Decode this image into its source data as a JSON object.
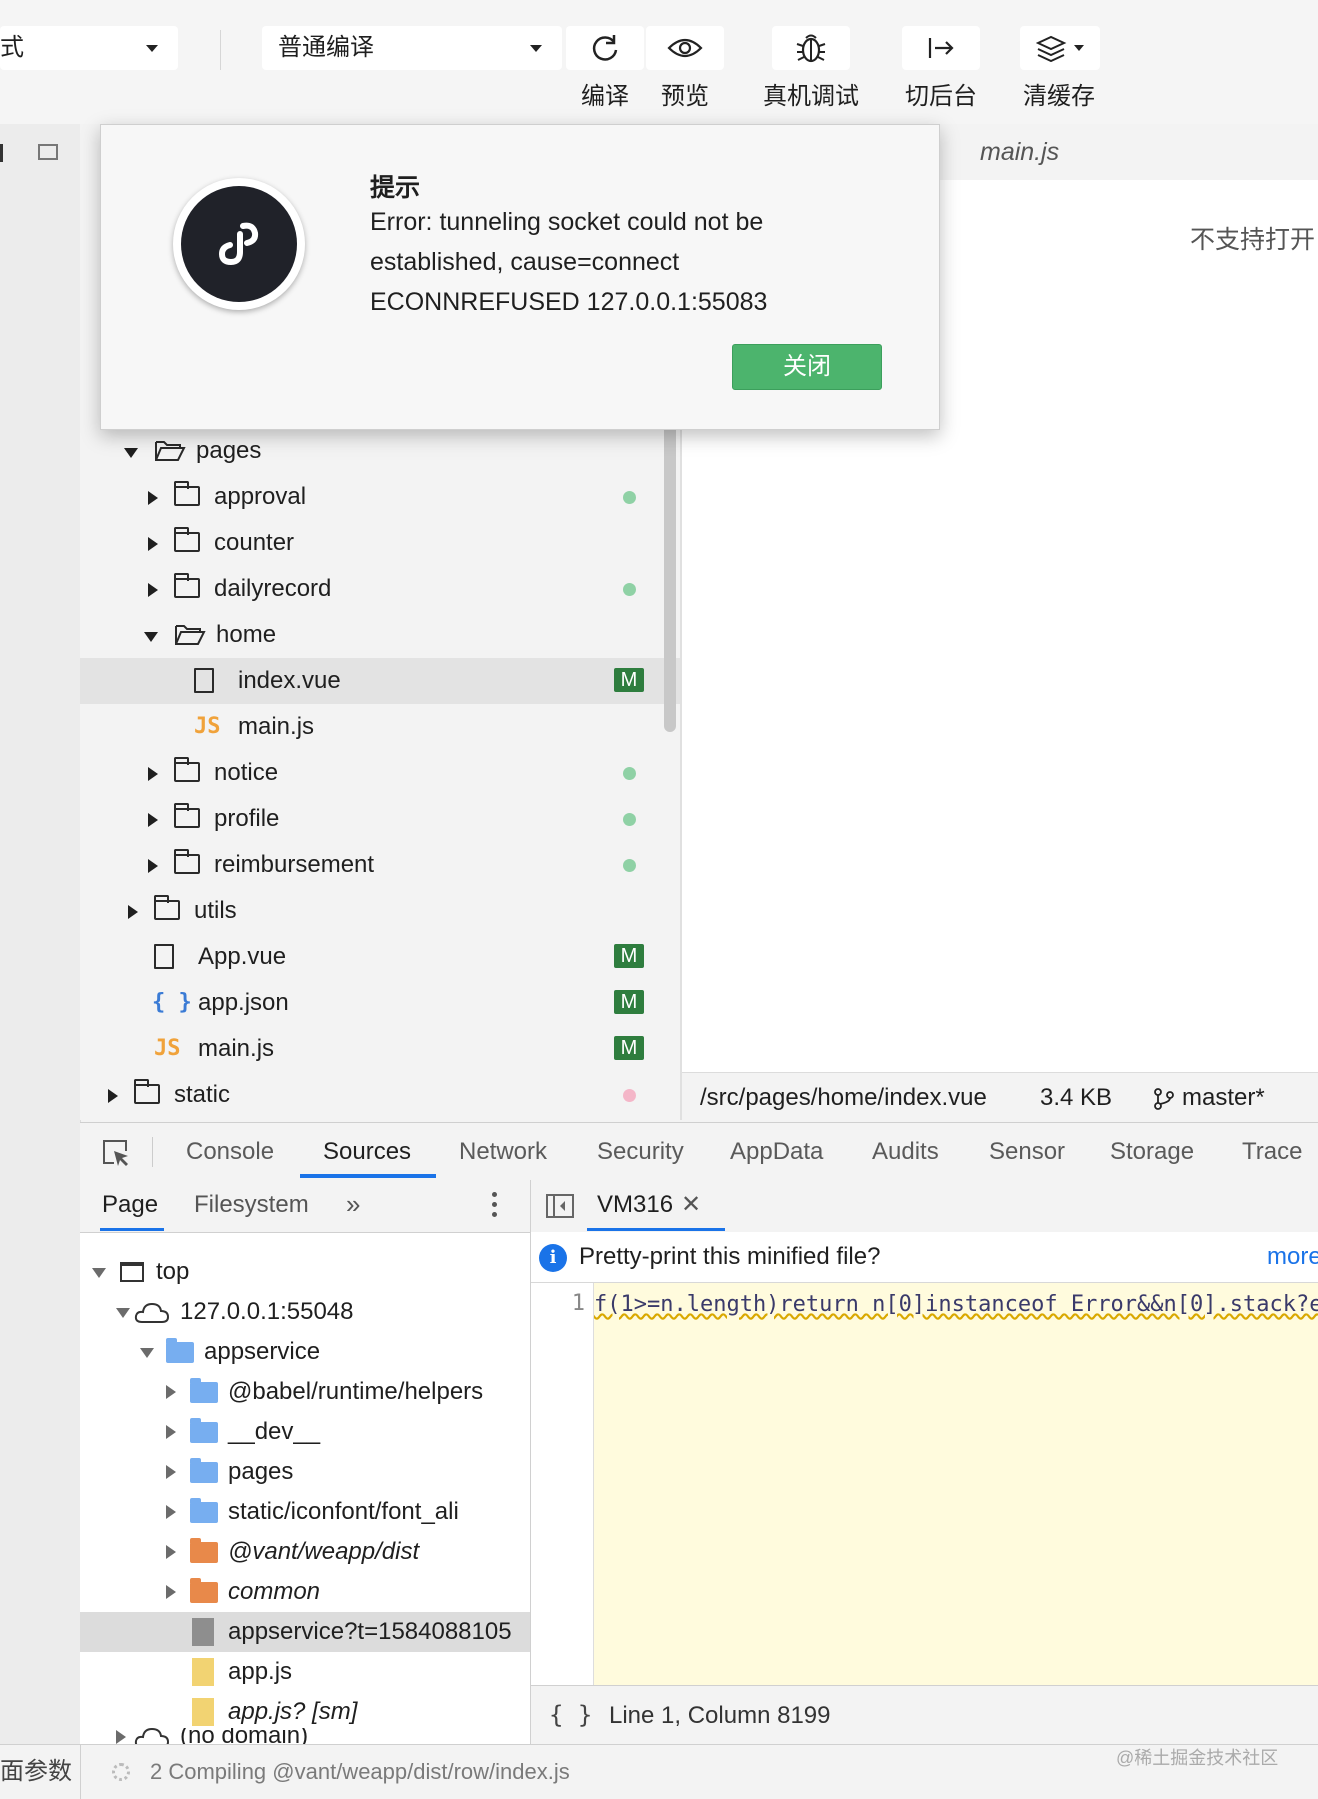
{
  "toolbar": {
    "mode_select": "式",
    "compile_select": "普通编译",
    "buttons": [
      {
        "name": "compile",
        "label": "编译",
        "icon": "refresh-icon"
      },
      {
        "name": "preview",
        "label": "预览",
        "icon": "eye-icon"
      },
      {
        "name": "remote-debug",
        "label": "真机调试",
        "icon": "bug-icon"
      },
      {
        "name": "background",
        "label": "切后台",
        "icon": "exit-arrow-icon"
      },
      {
        "name": "clear-cache",
        "label": "清缓存",
        "icon": "layers-icon"
      }
    ]
  },
  "editor": {
    "tab": "main.js",
    "unsupported_text": "不支持打开",
    "status": {
      "path": "/src/pages/home/index.vue",
      "size": "3.4 KB",
      "branch": "master*"
    }
  },
  "filetree": {
    "rows": [
      {
        "label": "pages",
        "type": "folder-open",
        "depth": 0
      },
      {
        "label": "approval",
        "type": "folder",
        "depth": 1,
        "status": "dot"
      },
      {
        "label": "counter",
        "type": "folder",
        "depth": 1
      },
      {
        "label": "dailyrecord",
        "type": "folder",
        "depth": 1,
        "status": "dot"
      },
      {
        "label": "home",
        "type": "folder-open",
        "depth": 1
      },
      {
        "label": "index.vue",
        "type": "file",
        "depth": 2,
        "status": "M",
        "selected": true
      },
      {
        "label": "main.js",
        "type": "js",
        "depth": 2
      },
      {
        "label": "notice",
        "type": "folder",
        "depth": 1,
        "status": "dot"
      },
      {
        "label": "profile",
        "type": "folder",
        "depth": 1,
        "status": "dot"
      },
      {
        "label": "reimbursement",
        "type": "folder",
        "depth": 1,
        "status": "dot"
      },
      {
        "label": "utils",
        "type": "folder",
        "depth": 0
      },
      {
        "label": "App.vue",
        "type": "file",
        "depth": 0,
        "status": "M"
      },
      {
        "label": "app.json",
        "type": "json",
        "depth": 0,
        "status": "M"
      },
      {
        "label": "main.js",
        "type": "js",
        "depth": 0,
        "status": "M"
      },
      {
        "label": "static",
        "type": "folder",
        "depth": -1,
        "status": "dot-pink"
      }
    ],
    "js_icon": "JS",
    "json_icon": "{ }",
    "modified_badge": "M"
  },
  "modal": {
    "title": "提示",
    "message": "Error: tunneling socket could not be established, cause=connect ECONNREFUSED 127.0.0.1:55083",
    "close_label": "关闭"
  },
  "devtools": {
    "tabs": [
      "Console",
      "Sources",
      "Network",
      "Security",
      "AppData",
      "Audits",
      "Sensor",
      "Storage",
      "Trace"
    ],
    "active_tab": "Sources",
    "navigator": {
      "tabs": [
        "Page",
        "Filesystem"
      ],
      "more": "»",
      "rows": [
        {
          "label": "top",
          "icon": "frame",
          "depth": 0,
          "expanded": true
        },
        {
          "label": "127.0.0.1:55048",
          "icon": "cloud",
          "depth": 1,
          "expanded": true
        },
        {
          "label": "appservice",
          "icon": "blue-folder",
          "depth": 2,
          "expanded": true
        },
        {
          "label": "@babel/runtime/helpers",
          "icon": "blue-folder",
          "depth": 3
        },
        {
          "label": "__dev__",
          "icon": "blue-folder",
          "depth": 3
        },
        {
          "label": "pages",
          "icon": "blue-folder",
          "depth": 3
        },
        {
          "label": "static/iconfont/font_ali",
          "icon": "blue-folder",
          "depth": 3
        },
        {
          "label": "@vant/weapp/dist",
          "icon": "orange-folder",
          "depth": 3,
          "italic": true
        },
        {
          "label": "common",
          "icon": "orange-folder",
          "depth": 3,
          "italic": true
        },
        {
          "label": "appservice?t=1584088105",
          "icon": "gray-file",
          "depth": 4,
          "selected": true
        },
        {
          "label": "app.js",
          "icon": "yellow-file",
          "depth": 4
        },
        {
          "label": "app.js? [sm]",
          "icon": "yellow-file",
          "depth": 4,
          "italic": true
        },
        {
          "label": "(no domain)",
          "icon": "cloud",
          "depth": 1
        }
      ]
    },
    "code": {
      "tab": "VM316",
      "pretty_print": "Pretty-print this minified file?",
      "more": "more",
      "line_number": "1",
      "line": "f(1>=n.length)return n[0]instanceof Error&&n[0].stack?e",
      "cursor": "Line 1, Column 8199",
      "format_icon": "{ }"
    }
  },
  "bottom": {
    "left": "面参数",
    "status": "2 Compiling @vant/weapp/dist/row/index.js",
    "watermark": "@稀土掘金技术社区"
  },
  "colors": {
    "accent": "#1a73e8",
    "ok_green": "#4cb46d",
    "modified": "#2e7d3e",
    "dot": "#8fd1a5"
  }
}
